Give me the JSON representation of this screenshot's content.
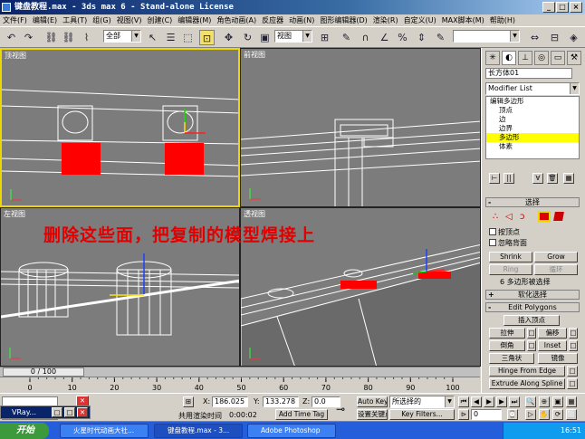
{
  "window": {
    "title": "键盘教程.max - 3ds max 6 - Stand-alone License"
  },
  "menu": [
    "文件(F)",
    "编辑(E)",
    "工具(T)",
    "组(G)",
    "视图(V)",
    "创建(C)",
    "编辑器(M)",
    "角色动画(A)",
    "反应器",
    "动画(N)",
    "图形编辑器(D)",
    "渲染(R)",
    "自定义(U)",
    "MAX脚本(M)",
    "帮助(H)"
  ],
  "toolbar": {
    "selection_filter": "全部",
    "ref_coord": "视图"
  },
  "viewports": {
    "top": "顶视图",
    "front": "前视图",
    "left": "左视图",
    "perspective": "透视图"
  },
  "annotation": "删除这些面，把复制的模型焊接上",
  "command_panel": {
    "object_name": "长方体01",
    "modifier_list": "Modifier List",
    "stack": [
      "编辑多边形",
      "顶点",
      "边",
      "边界",
      "多边形",
      "体素"
    ],
    "stack_selected_index": 4,
    "selection_rollout": "选择",
    "by_vertex": "按顶点",
    "ignore_backfacing": "忽略背面",
    "shrink": "Shrink",
    "grow": "Grow",
    "ring": "Ring",
    "loop": "循环",
    "selected_count": "6 多边形被选择",
    "soft_selection": "软化选择",
    "edit_polygons": "Edit Polygons",
    "insert_vertex": "插入顶点",
    "extrude": "拉伸",
    "outline": "偏移",
    "bevel": "倒角",
    "inset": "Inset",
    "triangulate": "三角状",
    "flip": "镜像",
    "hinge_from_edge": "Hinge From Edge",
    "extrude_along_spline": "Extrude Along Spline"
  },
  "time": {
    "frame_label": "0 / 100",
    "ticks": [
      "0",
      "10",
      "20",
      "30",
      "40",
      "50",
      "60",
      "70",
      "80",
      "90",
      "100"
    ]
  },
  "status": {
    "x_label": "X:",
    "x_value": "186.025",
    "y_label": "Y:",
    "y_value": "133.278",
    "z_label": "Z:",
    "z_value": "0.0",
    "prompt": "共用渲染时间",
    "render_time": "0:00:02",
    "add_time_tag": "Add Time Tag",
    "auto_key": "Auto Key",
    "set_key": "设置关键点",
    "key_filter_sel": "所选择的",
    "key_filters": "Key Filters...",
    "frame": "0",
    "vray_label": "VRay..."
  },
  "taskbar": {
    "start": "开始",
    "items": [
      "火星时代动画大社...",
      "键盘教程.max - 3...",
      "Adobe Photoshop"
    ],
    "clock": "16:51"
  },
  "colors": {
    "viewport_bg": "#7c7c7c",
    "active_border": "#ecd700",
    "selected_face": "#ff0000",
    "annotation": "#e00000",
    "stack_highlight": "#ffff00"
  }
}
